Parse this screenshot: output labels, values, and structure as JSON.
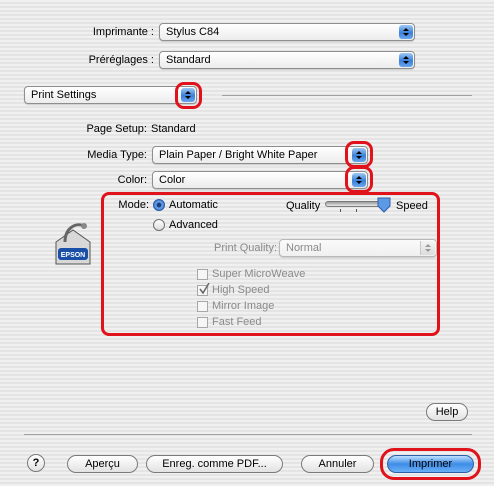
{
  "printer": {
    "label": "Imprimante :",
    "value": "Stylus C84"
  },
  "presets": {
    "label": "Préréglages :",
    "value": "Standard"
  },
  "panel_menu": {
    "value": "Print Settings"
  },
  "page_setup": {
    "label": "Page Setup:",
    "value": "Standard"
  },
  "media_type": {
    "label": "Media Type:",
    "value": "Plain Paper / Bright White Paper"
  },
  "color": {
    "label": "Color:",
    "value": "Color"
  },
  "mode": {
    "label": "Mode:",
    "automatic": "Automatic",
    "advanced": "Advanced",
    "selected": "Automatic"
  },
  "quality_slider": {
    "left_label": "Quality",
    "right_label": "Speed",
    "level": 1.0
  },
  "print_quality": {
    "label": "Print Quality:",
    "value": "Normal"
  },
  "options": [
    {
      "label": "Super MicroWeave",
      "checked": false
    },
    {
      "label": "High Speed",
      "checked": true
    },
    {
      "label": "Mirror Image",
      "checked": false
    },
    {
      "label": "Fast Feed",
      "checked": false
    }
  ],
  "logo": {
    "brand": "EPSON"
  },
  "buttons": {
    "help": "Help",
    "question": "?",
    "preview": "Aperçu",
    "save_pdf": "Enreg. comme PDF...",
    "cancel": "Annuler",
    "print": "Imprimer"
  },
  "colors": {
    "highlight": "#e0121b",
    "accent": "#3a80d8"
  }
}
